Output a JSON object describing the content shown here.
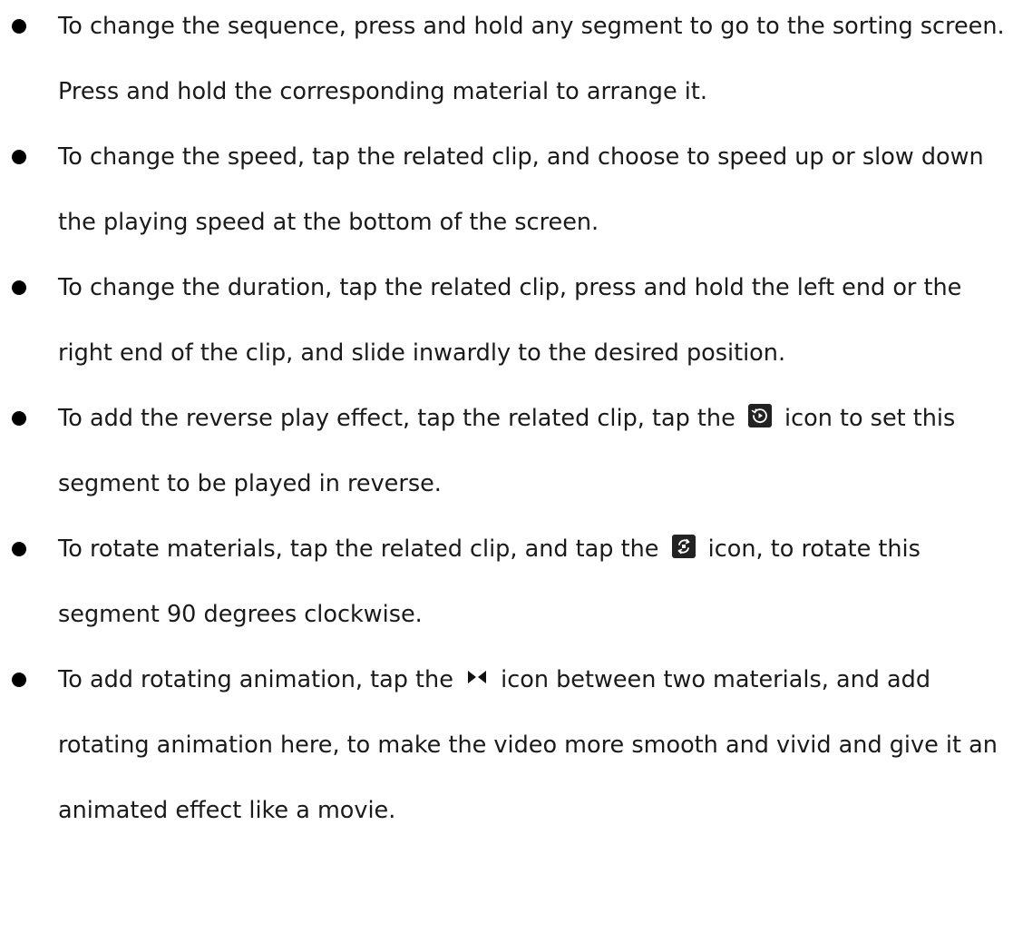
{
  "items": [
    {
      "text": "To change the sequence, press and hold any segment to go to the sorting screen. Press and hold the corresponding material to arrange it."
    },
    {
      "text": "To change the speed, tap the related clip, and choose to speed up or slow down the playing speed at the bottom of the screen."
    },
    {
      "text": "To change the duration, tap the related clip, press and hold the left end or the right end of the clip, and slide inwardly to the desired position."
    },
    {
      "before": "To add the reverse play effect, tap the related clip, tap the",
      "icon": "reverse-play-icon",
      "after": "icon to set this segment to be played in reverse."
    },
    {
      "before": "To rotate materials, tap the related clip, and tap the",
      "icon": "rotate-icon",
      "after": "icon, to rotate this segment 90 degrees clockwise."
    },
    {
      "before": "To add rotating animation, tap the",
      "icon": "transition-bowtie-icon",
      "after": "icon between two materials, and add rotating animation here, to make the video more smooth and vivid and give it an animated effect like a movie."
    }
  ]
}
